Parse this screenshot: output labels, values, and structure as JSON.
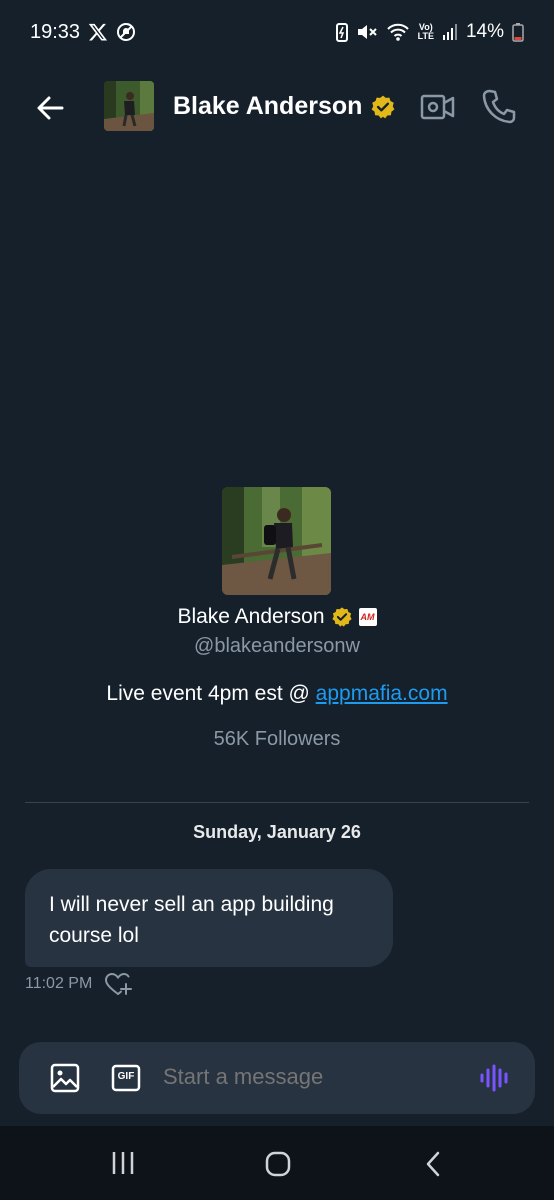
{
  "status_bar": {
    "time": "19:33",
    "battery": "14%",
    "icons": [
      "x-logo-icon",
      "do-not-disturb-icon",
      "battery-saver-icon",
      "mute-icon",
      "wifi-icon",
      "volte-icon",
      "signal-icon",
      "battery-icon"
    ],
    "volte_line1": "Vo)",
    "volte_line2": "LTE"
  },
  "header": {
    "name": "Blake Anderson",
    "verified": true,
    "icons": [
      "back-arrow-icon",
      "video-call-icon",
      "phone-icon"
    ]
  },
  "profile": {
    "name": "Blake Anderson",
    "affiliate_badge": "AM",
    "handle": "@blakeandersonw",
    "bio_text": "Live event 4pm est @ ",
    "bio_link": "appmafia.com",
    "followers": "56K Followers"
  },
  "conversation": {
    "date": "Sunday, January 26",
    "messages": [
      {
        "text": "I will never sell an app building course lol",
        "time": "11:02 PM"
      }
    ]
  },
  "composer": {
    "placeholder": "Start a message",
    "gif_label": "GIF",
    "icons": [
      "image-icon",
      "gif-icon",
      "voice-message-icon"
    ]
  },
  "nav_bar": {
    "icons": [
      "recents-icon",
      "home-icon",
      "nav-back-icon"
    ]
  },
  "colors": {
    "background": "#15202b",
    "bubble": "#273340",
    "accent_link": "#1d9bf0",
    "verified_gold": "#e2b719",
    "voice_purple": "#7856ff",
    "muted_text": "#8b98a5"
  }
}
